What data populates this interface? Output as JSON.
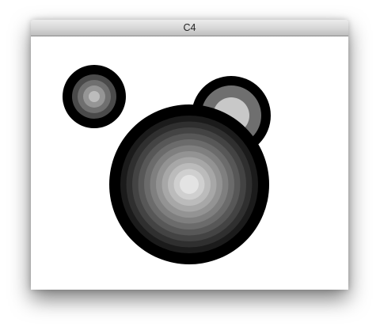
{
  "window": {
    "title": "C4"
  },
  "canvas": {
    "background": "#ffffff",
    "targets": [
      {
        "name": "small-target",
        "ring_colors": [
          "#000000",
          "#4a4a4a",
          "#6f6f6f",
          "#959595",
          "#bcbcbc",
          "#e1e1e1"
        ]
      },
      {
        "name": "medium-target",
        "ring_colors": [
          "#000000",
          "#6f6f6f",
          "#c8c8c8"
        ]
      },
      {
        "name": "large-target",
        "ring_colors": [
          "#000000",
          "#1b1b1b",
          "#2f2f2f",
          "#434343",
          "#575757",
          "#6b6b6b",
          "#7f7f7f",
          "#939393",
          "#a7a7a7",
          "#bbbbbb",
          "#cfcfcf",
          "#e3e3e3"
        ]
      }
    ]
  }
}
